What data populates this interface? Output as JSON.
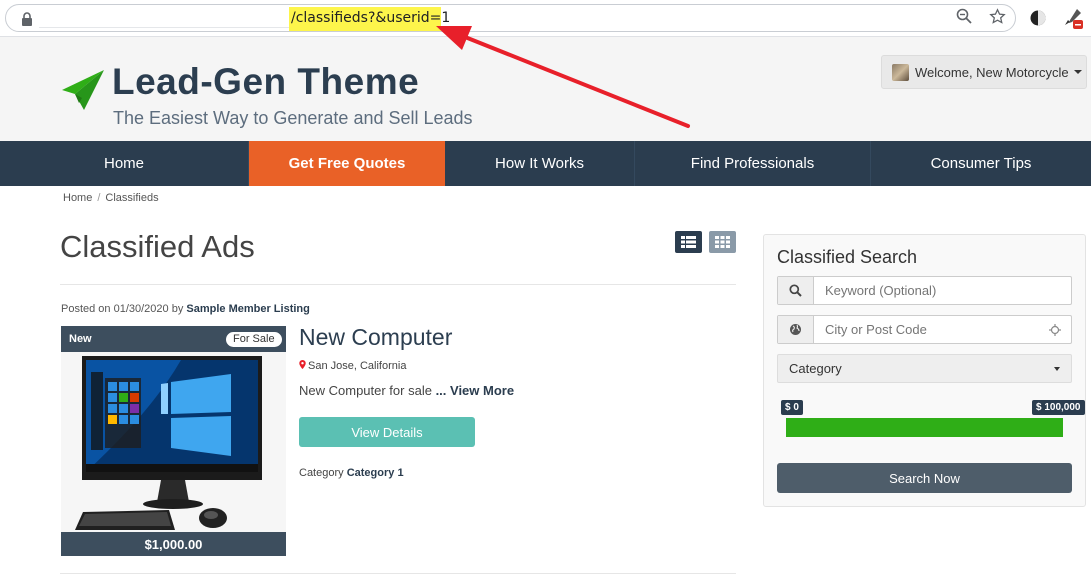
{
  "browser": {
    "url_visible": "/classifieds?&userid=1"
  },
  "header": {
    "site_title": "Lead-Gen Theme",
    "tagline": "The Easiest Way to Generate and Sell Leads",
    "welcome_label": "Welcome, New Motorcycle"
  },
  "nav": {
    "items": [
      {
        "label": "Home",
        "active": false
      },
      {
        "label": "Get Free Quotes",
        "active": true
      },
      {
        "label": "How It Works",
        "active": false
      },
      {
        "label": "Find Professionals",
        "active": false
      },
      {
        "label": "Consumer Tips",
        "active": false
      }
    ]
  },
  "breadcrumb": {
    "items": [
      "Home",
      "Classifieds"
    ]
  },
  "main": {
    "page_title": "Classified Ads",
    "listing": {
      "posted_prefix": "Posted on 01/30/2020 by ",
      "posted_by": "Sample Member Listing",
      "badge_new": "New",
      "badge_status": "For Sale",
      "price": "$1,000.00",
      "title": "New Computer",
      "location": "San Jose, California",
      "description": "New Computer for sale ",
      "view_more": "... View More",
      "view_details_label": "View Details",
      "category_prefix": "Category ",
      "category": "Category 1"
    }
  },
  "search": {
    "title": "Classified Search",
    "keyword_placeholder": "Keyword (Optional)",
    "location_placeholder": "City or Post Code",
    "category_selected": "Category",
    "price_min": "$ 0",
    "price_max": "$ 100,000",
    "price_range_fraction": [
      0,
      1
    ],
    "button_label": "Search Now"
  },
  "colors": {
    "nav_bg": "#2b3d4f",
    "nav_active": "#e96127",
    "accent_teal": "#5bc0b3",
    "slider_green": "#2fae17",
    "url_highlight": "#fdf54b",
    "annotation_red": "#e8202a"
  }
}
